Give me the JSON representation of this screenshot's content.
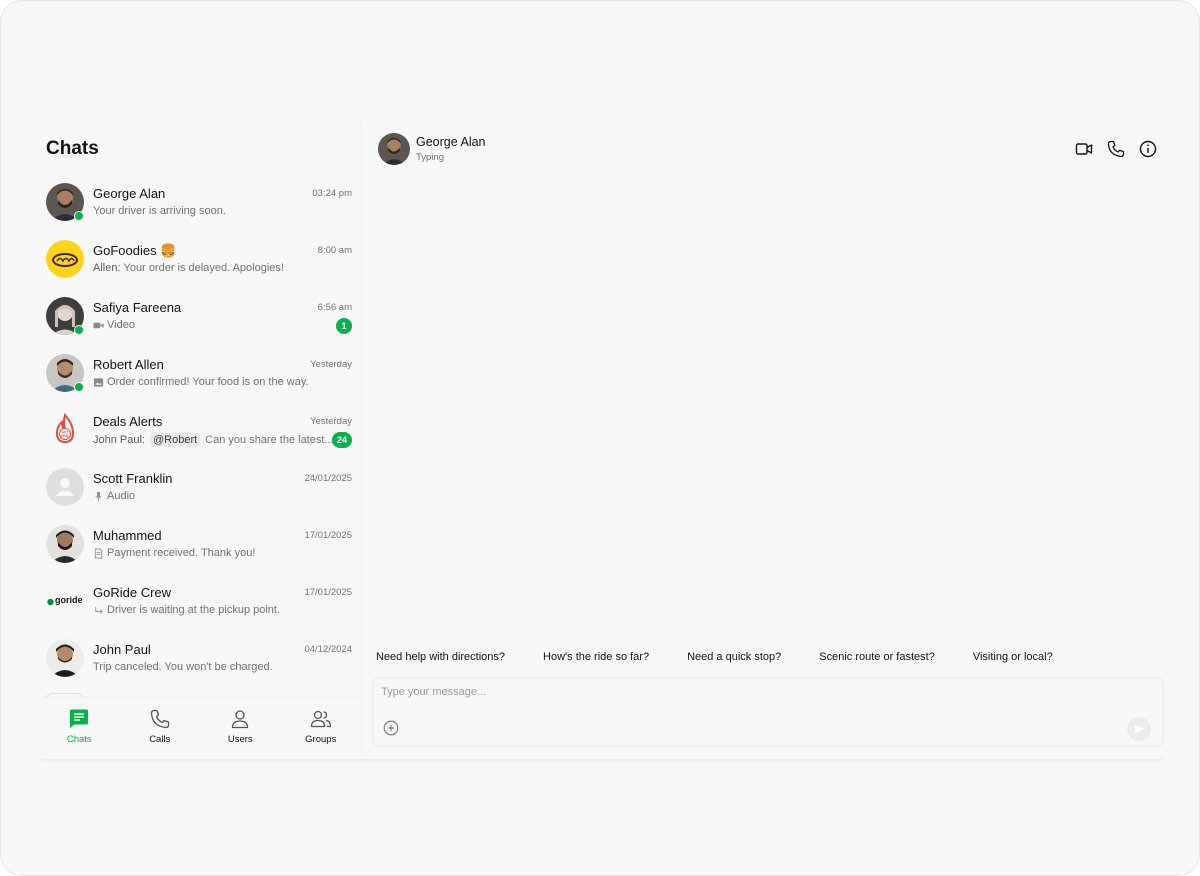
{
  "colors": {
    "accent": "#09b14e",
    "background": "#f7f7f7",
    "text_primary": "#141414",
    "text_secondary": "#727272"
  },
  "sidebar": {
    "title": "Chats",
    "chats": [
      {
        "name": "George Alan",
        "time": "03:24 pm",
        "preview": "Your driver is arriving soon.",
        "online": true,
        "avatar": "photo-george"
      },
      {
        "name": "GoFoodies 🍔",
        "time": "8:00 am",
        "sender": "Allen:",
        "preview": "Your order is delayed. Apologies!",
        "avatar": "gofoodies-logo"
      },
      {
        "name": "Safiya Fareena",
        "time": "6:56 am",
        "preview": "Video",
        "preview_icon": "video-icon",
        "unread": "1",
        "online": true,
        "avatar": "photo-safiya"
      },
      {
        "name": "Robert Allen",
        "time": "Yesterday",
        "preview": "Order confirmed! Your food is on the way.",
        "preview_icon": "image-icon",
        "online": true,
        "avatar": "photo-robert"
      },
      {
        "name": "Deals Alerts",
        "time": "Yesterday",
        "sender": "John Paul:",
        "mention": "@Robert",
        "preview": "Can you share the latest...",
        "unread": "24",
        "avatar": "hot-deal-logo"
      },
      {
        "name": "Scott Franklin",
        "time": "24/01/2025",
        "preview": "Audio",
        "preview_icon": "mic-icon",
        "avatar": "default-user"
      },
      {
        "name": "Muhammed",
        "time": "17/01/2025",
        "preview": "Payment received. Thank you!",
        "preview_icon": "file-icon",
        "avatar": "photo-muhammed"
      },
      {
        "name": "GoRide Crew",
        "time": "17/01/2025",
        "preview": "Driver is waiting at the pickup point.",
        "preview_icon": "reply-icon",
        "avatar": "goride-logo",
        "logo_text": "goride"
      },
      {
        "name": "John Paul",
        "time": "04/12/2024",
        "preview": "Trip canceled. You won't be charged.",
        "avatar": "photo-john"
      }
    ]
  },
  "bottom_nav": {
    "items": [
      {
        "label": "Chats",
        "icon": "chat-icon",
        "active": true
      },
      {
        "label": "Calls",
        "icon": "phone-icon"
      },
      {
        "label": "Users",
        "icon": "user-icon"
      },
      {
        "label": "Groups",
        "icon": "groups-icon"
      }
    ]
  },
  "conversation": {
    "name": "George Alan",
    "status": "Typing",
    "actions": [
      "video-call-icon",
      "voice-call-icon",
      "info-icon"
    ],
    "suggestions": [
      "Need help with directions?",
      "How's the ride so far?",
      "Need a quick stop?",
      "Scenic route or fastest?",
      "Visiting or local?"
    ],
    "composer": {
      "placeholder": "Type your message...",
      "value": ""
    }
  }
}
